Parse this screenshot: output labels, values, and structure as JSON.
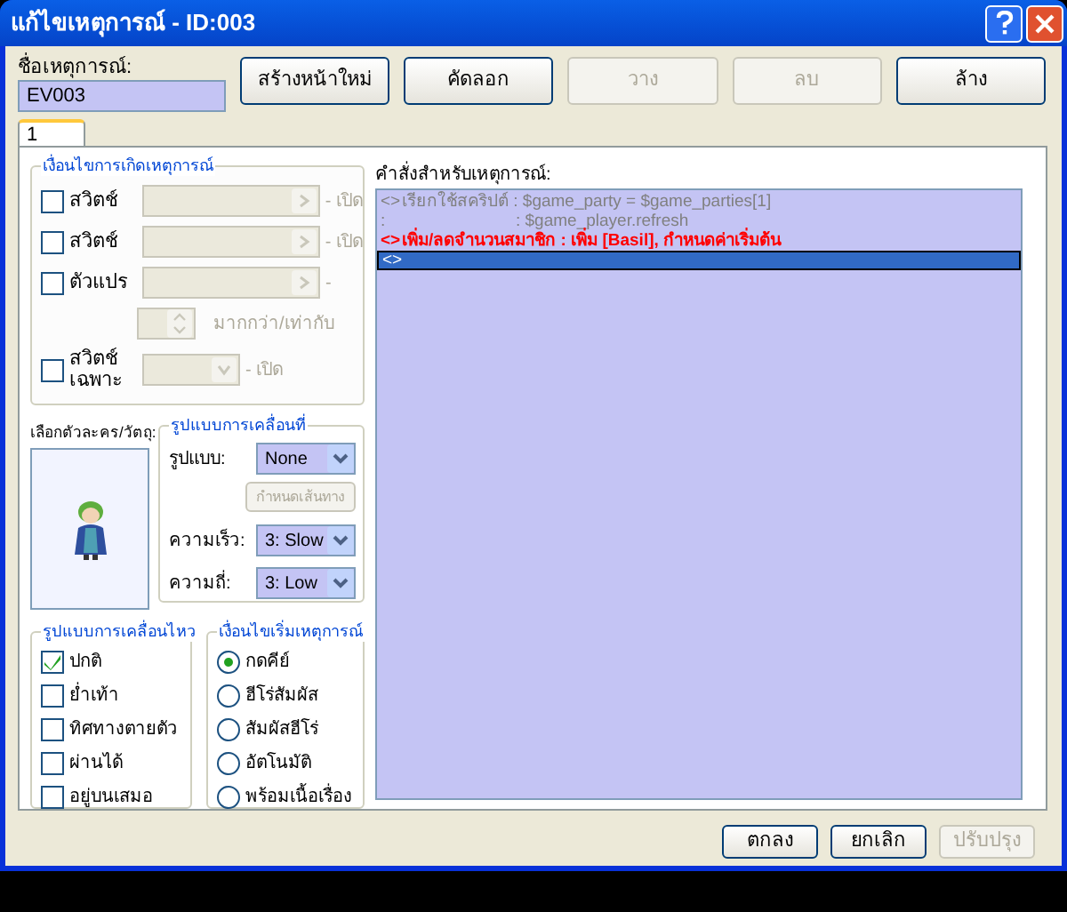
{
  "window": {
    "title": "แก้ไขเหตุการณ์ - ID:003"
  },
  "event_name": {
    "label": "ชื่อเหตุการณ์:",
    "value": "EV003"
  },
  "toolbar": [
    {
      "label": "สร้างหน้าใหม่",
      "disabled": false
    },
    {
      "label": "คัดลอก",
      "disabled": false
    },
    {
      "label": "วาง",
      "disabled": true
    },
    {
      "label": "ลบ",
      "disabled": true
    },
    {
      "label": "ล้าง",
      "disabled": false
    }
  ],
  "tabs": [
    {
      "label": "1",
      "selected": true
    }
  ],
  "conditions": {
    "title": "เงื่อนไขการเกิดเหตุการณ์",
    "items": [
      {
        "kind": "switch",
        "label": "สวิตช์",
        "checked": false,
        "suffix": "- เปิด"
      },
      {
        "kind": "switch",
        "label": "สวิตช์",
        "checked": false,
        "suffix": "- เปิด"
      },
      {
        "kind": "variable",
        "label": "ตัวแปร",
        "checked": false,
        "suffix": "-",
        "compare": "มากกว่า/เท่ากับ"
      },
      {
        "kind": "self_switch",
        "label": "สวิตช์ เฉพาะ",
        "checked": false,
        "suffix": "- เปิด"
      }
    ]
  },
  "graphic": {
    "label": "เลือกตัวละคร/วัตถุ:"
  },
  "movement": {
    "title": "รูปแบบการเคลื่อนที่",
    "type_label": "รูปแบบ:",
    "type": "None",
    "route_button": "กำหนดเส้นทาง",
    "speed_label": "ความเร็ว:",
    "speed": "3: Slow",
    "freq_label": "ความถี่:",
    "freq": "3: Low"
  },
  "options": {
    "title": "รูปแบบการเคลื่อนไหว",
    "items": [
      {
        "label": "ปกติ",
        "checked": true
      },
      {
        "label": "ย่ำเท้า",
        "checked": false
      },
      {
        "label": "ทิศทางตายตัว",
        "checked": false
      },
      {
        "label": "ผ่านได้",
        "checked": false
      },
      {
        "label": "อยู่บนเสมอ",
        "checked": false
      }
    ]
  },
  "trigger": {
    "title": "เงื่อนไขเริ่มเหตุการณ์",
    "items": [
      {
        "label": "กดคีย์",
        "selected": true
      },
      {
        "label": "ฮีโร่สัมผัส",
        "selected": false
      },
      {
        "label": "สัมผัสฮีโร่",
        "selected": false
      },
      {
        "label": "อัตโนมัติ",
        "selected": false
      },
      {
        "label": "พร้อมเนื้อเรื่อง",
        "selected": false
      }
    ]
  },
  "commands": {
    "label": "คำสั่งสำหรับเหตุการณ์:",
    "rows": [
      {
        "marker": "<>",
        "text": "เรียกใช้สคริปต์ : $game_party = $game_parties[1]",
        "color": "#808080",
        "selected": false
      },
      {
        "marker": ":",
        "text": ": $game_player.refresh",
        "color": "#808080",
        "selected": false
      },
      {
        "marker": "<>",
        "text": "เพิ่ม/ลดจำนวนสมาชิก : เพิ่ม [Basil], กำหนดค่าเริ่มต้น",
        "color": "#ff0000",
        "selected": false
      },
      {
        "marker": "<>",
        "text": "",
        "color": "#000000",
        "selected": true
      }
    ]
  },
  "footer": [
    {
      "label": "ตกลง",
      "disabled": false
    },
    {
      "label": "ยกเลิก",
      "disabled": false
    },
    {
      "label": "ปรับปรุง",
      "disabled": true
    }
  ]
}
